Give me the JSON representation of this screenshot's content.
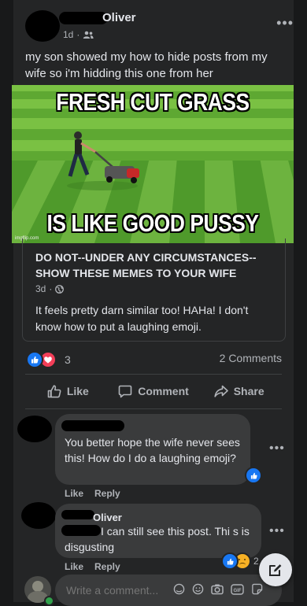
{
  "post": {
    "author_name": "Oliver",
    "time": "1d",
    "text": "my son showed my how to hide posts from my wife so i'm hidding this one from her",
    "meme": {
      "top_text": "FRESH CUT GRASS",
      "bottom_text": "IS LIKE GOOD PUSSY",
      "watermark": "imgflip.com"
    }
  },
  "shared_post": {
    "title": "DO NOT--UNDER ANY CIRCUMSTANCES--SHOW THESE MEMES TO YOUR WIFE",
    "time": "3d",
    "text": "It feels pretty darn similar too! HAHa! I don't know how to put a laughing emoji."
  },
  "stats": {
    "reaction_count": "3",
    "comments_count": "2 Comments"
  },
  "actions": {
    "like": "Like",
    "comment": "Comment",
    "share": "Share"
  },
  "comments": [
    {
      "author": "",
      "text": "You better hope the wife never sees this! How do I do a laughing emoji?",
      "like_label": "Like",
      "reply_label": "Reply",
      "reaction_count": ""
    },
    {
      "author": "Oliver",
      "text": "I can still see this post. Thi s is disgusting",
      "like_label": "Like",
      "reply_label": "Reply",
      "reaction_count": "2"
    }
  ],
  "composer": {
    "placeholder": "Write a comment..."
  },
  "icons": {
    "audience": "friends-icon",
    "shared_audience": "globe-icon",
    "more": "more-horizontal-icon",
    "fab": "compose-icon"
  },
  "colors": {
    "background": "#18191a",
    "card": "#242526",
    "bubble": "#3a3b3c",
    "like_blue": "#1877f2",
    "love_red": "#f33e58",
    "grass_light": "#7ac143",
    "grass_dark": "#4f9a2b"
  }
}
